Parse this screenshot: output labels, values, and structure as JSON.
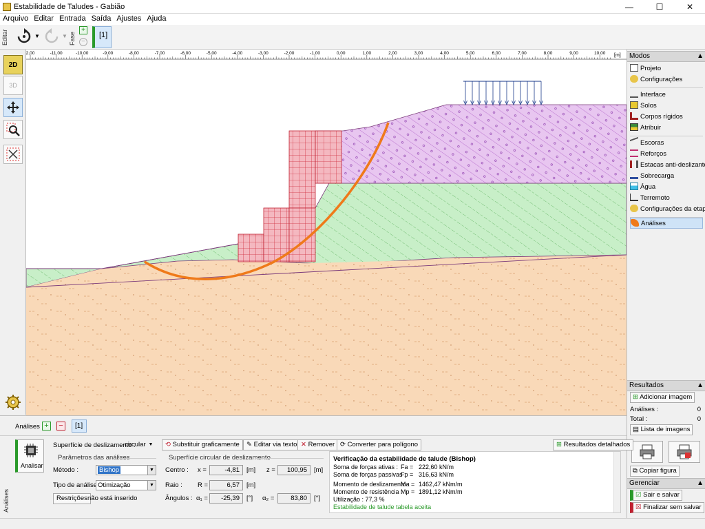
{
  "window": {
    "title": "Estabilidade de Taludes - Gabião",
    "minimize": "—",
    "maximize": "☐",
    "close": "✕"
  },
  "menu": [
    "Arquivo",
    "Editar",
    "Entrada",
    "Saída",
    "Ajustes",
    "Ajuda"
  ],
  "toolbar": {
    "editor_label": "Editar",
    "fase_label": "Fase",
    "stage_tab": "[1]"
  },
  "left_tools": {
    "view_2d": "2D",
    "view_3d": "3D"
  },
  "ruler": {
    "unit": "[m]",
    "ticks": [
      "2,00",
      "-11,00",
      "-10,00",
      "-9,00",
      "-8,00",
      "-7,00",
      "-6,00",
      "-5,00",
      "-4,00",
      "-3,00",
      "-2,00",
      "-1,00",
      "0,00",
      "1,00",
      "2,00",
      "3,00",
      "4,00",
      "5,00",
      "6,00",
      "7,00",
      "8,00",
      "9,00",
      "10,00"
    ]
  },
  "right_panel": {
    "modes_title": "Modos",
    "group1": [
      "Projeto",
      "Configurações"
    ],
    "group2": [
      "Interface",
      "Solos",
      "Corpos rígidos",
      "Atribuir"
    ],
    "group3": [
      "Escoras",
      "Reforços",
      "Estacas anti-deslizantes",
      "Sobrecarga",
      "Água",
      "Terremoto",
      "Configurações da etapa"
    ],
    "group4": [
      "Análises"
    ],
    "results_title": "Resultados",
    "add_image": "Adicionar imagem",
    "analyses_label": "Análises :",
    "analyses_value": "0",
    "total_label": "Total :",
    "total_value": "0",
    "image_list": "Lista de imagens",
    "copy_figure": "Copiar figura",
    "manage_title": "Gerenciar",
    "save_exit": "Sair e salvar",
    "exit_nosave": "Finalizar sem salvar"
  },
  "bottom": {
    "side_label": "Análises",
    "analyses_label": "Análises :",
    "analysis_tab": "[1]",
    "run_button": "Analisar",
    "surface_label": "Superfície de deslizamento :",
    "surface_value": "circular",
    "replace_graphic": "Substituir graficamente",
    "edit_text": "Editar via texto",
    "remove": "Remover",
    "convert_polygon": "Converter para polígono",
    "detailed_results": "Resultados detalhados",
    "params_group": "Parâmetros das análises",
    "method_label": "Método :",
    "method_value": "Bishop",
    "analysis_type_label": "Tipo de análise :",
    "analysis_type_value": "Otimização",
    "restrictions_button": "Restrições",
    "restrictions_status": "não está inserido",
    "circle_group": "Superfície circular de deslizamento",
    "center_label": "Centro :",
    "x_label": "x =",
    "x_value": "-4,81",
    "z_label": "z =",
    "z_value": "100,95",
    "unit_m": "[m]",
    "radius_label": "Raio :",
    "r_label": "R =",
    "r_value": "6,57",
    "angles_label": "Ângulos :",
    "a1_label": "α₁ =",
    "a1_value": "-25,39",
    "a2_label": "α₂ =",
    "a2_value": "83,80",
    "unit_deg": "[°]"
  },
  "results": {
    "title": "Verificação da estabilidade de talude (Bishop)",
    "active_label": "Soma de forças ativas :",
    "active_sym": "Fa =",
    "active_value": "222,60 kN/m",
    "passive_label": "Soma de forças passivas :",
    "passive_sym": "Fp =",
    "passive_value": "316,63 kN/m",
    "sliding_label": "Momento de deslizamento :",
    "sliding_sym": "Ma =",
    "sliding_value": "1462,47 kNm/m",
    "resist_label": "Momento de resistência :",
    "resist_sym": "Mp =",
    "resist_value": "1891,12 kNm/m",
    "utilization": "Utilização : 77,3  %",
    "verdict": "Estabilidade de talude tabela aceita",
    "verdict_color": "#2a9a2a"
  },
  "colors": {
    "sand": "#f9d9b8",
    "green": "#c8efc8",
    "purple": "#e8c6f0",
    "gabion": "#f4b8c0",
    "slip": "#ef7a1a"
  }
}
